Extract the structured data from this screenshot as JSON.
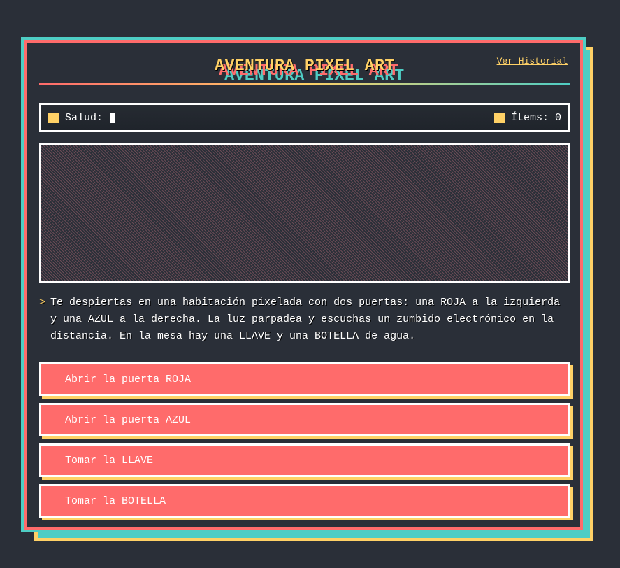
{
  "header": {
    "title": "AVENTURA PIXEL ART",
    "history_link": "Ver Historial"
  },
  "status": {
    "health_label": "Salud:",
    "health_icon": "square-icon",
    "items_label": "Ítems:",
    "items_value": "0",
    "items_icon": "square-icon"
  },
  "narrative": {
    "prompt": ">",
    "text": "Te despiertas en una habitación pixelada con dos puertas: una ROJA a la izquierda y una AZUL a la derecha. La luz parpadea y escuchas un zumbido electrónico en la distancia. En la mesa hay una LLAVE y una BOTELLA de agua."
  },
  "choices": [
    {
      "label": "Abrir la puerta ROJA"
    },
    {
      "label": "Abrir la puerta AZUL"
    },
    {
      "label": "Tomar la LLAVE"
    },
    {
      "label": "Tomar la BOTELLA"
    }
  ],
  "colors": {
    "background": "#2a2f38",
    "coral": "#ff6b6b",
    "yellow": "#ffd166",
    "teal": "#4ecdc4",
    "white": "#ffffff"
  }
}
